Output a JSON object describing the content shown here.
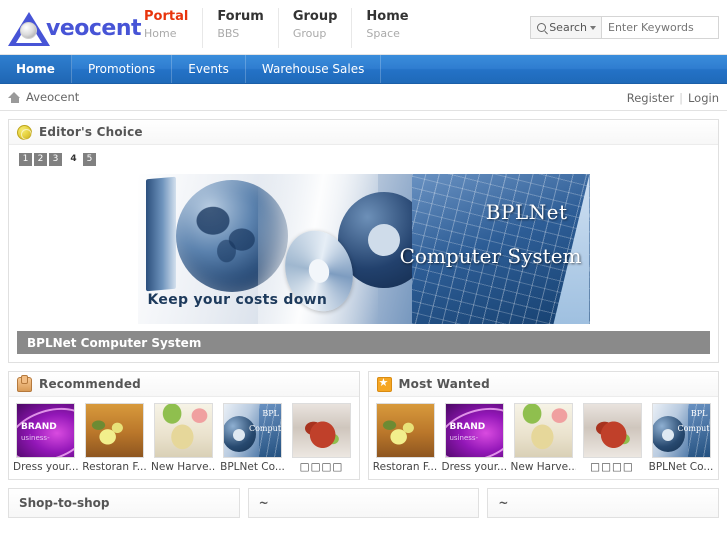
{
  "header": {
    "logo_text": "veocent",
    "logo_icon": "aveocent-triangle-logo",
    "nav": [
      {
        "title": "Portal",
        "sub": "Home",
        "active": true
      },
      {
        "title": "Forum",
        "sub": "BBS",
        "active": false
      },
      {
        "title": "Group",
        "sub": "Group",
        "active": false
      },
      {
        "title": "Home",
        "sub": "Space",
        "active": false
      }
    ],
    "search": {
      "button_label": "Search",
      "icon": "search-icon",
      "caret_icon": "chevron-down-icon",
      "placeholder": "Enter Keywords",
      "value": ""
    }
  },
  "mainnav": {
    "items": [
      {
        "label": "Home",
        "active": true
      },
      {
        "label": "Promotions",
        "active": false
      },
      {
        "label": "Events",
        "active": false
      },
      {
        "label": "Warehouse Sales",
        "active": false
      }
    ]
  },
  "breadcrumb": {
    "home_icon": "home-icon",
    "text": "Aveocent",
    "register": "Register",
    "separator": "|",
    "login": "Login"
  },
  "editors_choice": {
    "icon": "medal-icon",
    "title": "Editor's Choice",
    "pager": [
      {
        "label": "1",
        "active": false
      },
      {
        "label": "2",
        "active": false
      },
      {
        "label": "3",
        "active": false
      },
      {
        "label": "4",
        "active": true
      },
      {
        "label": "5",
        "active": false
      }
    ],
    "banner": {
      "brand": "BPLNet",
      "product": "Computer System",
      "tagline": "Keep your costs down"
    },
    "caption": "BPLNet Computer System"
  },
  "recommended": {
    "icon": "pointing-hand-icon",
    "title": "Recommended",
    "items": [
      {
        "label": "Dress your...",
        "art": "art-brand",
        "brand_text": "BRAND",
        "brand_sub": "usiness-"
      },
      {
        "label": "Restoran F...",
        "art": "art-food1"
      },
      {
        "label": "New Harve...",
        "art": "art-food2"
      },
      {
        "label": "BPLNet Co...",
        "art": "art-bpl",
        "art_t1": "BPL",
        "art_t2": "Comput"
      },
      {
        "label": "□□□□",
        "art": "art-food3",
        "cjk": true
      }
    ]
  },
  "most_wanted": {
    "icon": "star-badge-icon",
    "title": "Most Wanted",
    "items": [
      {
        "label": "Restoran F...",
        "art": "art-food1"
      },
      {
        "label": "Dress your...",
        "art": "art-brand",
        "brand_text": "BRAND",
        "brand_sub": "usiness-"
      },
      {
        "label": "New Harve...",
        "art": "art-food2"
      },
      {
        "label": "□□□□",
        "art": "art-food3",
        "cjk": true
      },
      {
        "label": "BPLNet Co...",
        "art": "art-bpl",
        "art_t1": "BPL",
        "art_t2": "Comput"
      }
    ]
  },
  "bottom_panels": [
    {
      "title": "Shop-to-shop"
    },
    {
      "title": "~"
    },
    {
      "title": "~"
    }
  ],
  "colors": {
    "accent_blue": "#2472c7",
    "portal_red": "#e8340c",
    "caption_gray": "#8a8a8a",
    "logo_blue": "#4754d6"
  }
}
